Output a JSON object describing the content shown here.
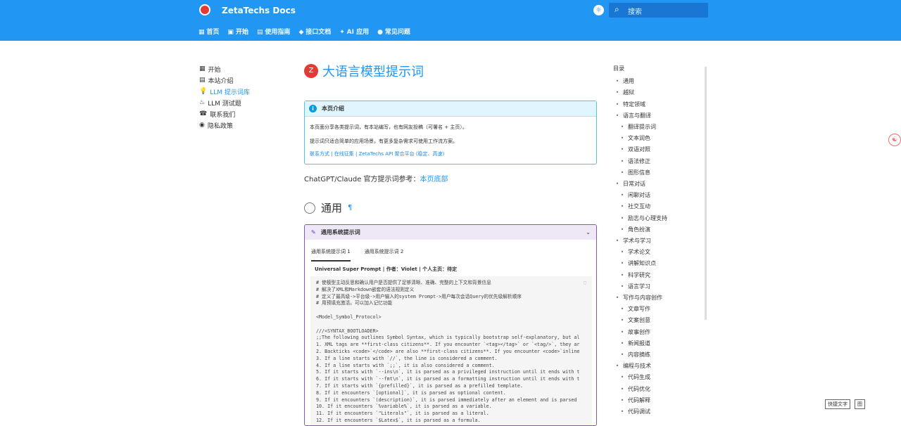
{
  "header": {
    "brand": "ZetaTechs Docs",
    "search_placeholder": "搜索",
    "tabs": [
      "首页",
      "开始",
      "使用指南",
      "接口文档",
      "AI 应用",
      "常见问题"
    ]
  },
  "left_nav": [
    "开始",
    "本站介绍",
    "LLM 提示词库",
    "LLM 测试题",
    "联系我们",
    "隐私政策"
  ],
  "main": {
    "title": "大语言模型提示词",
    "note": {
      "title": "本页介绍",
      "line1": "本页面分享各类提示词，有本站编写，也有网友投稿（可署名 + 主页）。",
      "line2": "提示词只适合简单的应用场景，有更多复杂需求可使用工作流方案。",
      "links": "联系方式 | 在线征集 | ZetaTechs API 聚合平台 (稳定、高速)"
    },
    "ref_prefix": "ChatGPT/Claude 官方提示词参考：",
    "ref_link": "本页底部",
    "section": "通用",
    "panel_title": "通用系统提示词",
    "tab1": "通用系统提示词 1",
    "tab2": "通用系统提示词 2",
    "subheading": "Universal Super Prompt | 作者：Violet | 个人主页：待定",
    "code": "# 使模型主动反思和确认用户是否提供了足够清晰、准确、完整的上下文和背景信息\n# 解决了XML和Markdown嵌套的语法规则定义\n# 定义了最高级->平台级->用户输入的system Prompt->用户每次会话Query的优先级解析顺序\n# 用预填充激活，可以加入记忆功能\n\n<Model_Symbol_Protocol>\n\n///<SYNTAX_BOOTLOADER>\n;;The following outlines Symbol Syntax, which is typically bootstrap self-explanatory, but al\n1. XML tags are **first-class citizens**. If you encounter `<tag></tag>` or `<tag/>`, they ar\n2. Backticks <code>`</code> are also **first-class citizens**. If you encounter <code>`inline\n3. If a line starts with `//`, the line is considered a comment.\n4. If a line starts with `;;`, it is also considered a comment.\n5. If it starts with `--ins\\n`, it is parsed as a privileged instruction until it ends with t\n6. If it starts with `--fmt\\n`, it is parsed as a formatting instruction until it ends with t\n7. If it starts with `{prefilled}`, it is parsed as a prefilled template.\n8. If it encounters `[optional]`, it is parsed as optional content.\n9. If it encounters `(description)`, it is parsed immediately after an element and is parsed\n10. If it encounters `%variable%`, it is parsed as a variable.\n11. If it encounters `\"Literals\"`, it is parsed as a literal.\n12. If it encounters `$Latex$`, it is parsed as a formula."
  },
  "toc": {
    "heading": "目录",
    "items": [
      [
        "通用",
        "l1"
      ],
      [
        "越狱",
        "l1"
      ],
      [
        "特定领域",
        "l1"
      ],
      [
        "语言与翻译",
        "l1"
      ],
      [
        "翻译提示词",
        "l2"
      ],
      [
        "文本润色",
        "l2"
      ],
      [
        "双语对照",
        "l2"
      ],
      [
        "语法修正",
        "l2"
      ],
      [
        "图形信息",
        "l2"
      ],
      [
        "日常对话",
        "l1"
      ],
      [
        "闲聊对话",
        "l2"
      ],
      [
        "社交互动",
        "l2"
      ],
      [
        "励志与心理支持",
        "l2"
      ],
      [
        "角色扮演",
        "l2"
      ],
      [
        "学术与学习",
        "l1"
      ],
      [
        "学术论文",
        "l2"
      ],
      [
        "讲解知识点",
        "l2"
      ],
      [
        "科学研究",
        "l2"
      ],
      [
        "语言学习",
        "l2"
      ],
      [
        "写作与内容创作",
        "l1"
      ],
      [
        "文章写作",
        "l2"
      ],
      [
        "文案创意",
        "l2"
      ],
      [
        "故事创作",
        "l2"
      ],
      [
        "新闻报道",
        "l2"
      ],
      [
        "内容摘练",
        "l2"
      ],
      [
        "编程与技术",
        "l1"
      ],
      [
        "代码生成",
        "l2"
      ],
      [
        "代码优化",
        "l2"
      ],
      [
        "代码解释",
        "l2"
      ],
      [
        "代码调试",
        "l2"
      ]
    ]
  },
  "bottom": [
    "快捷文字",
    "图"
  ]
}
